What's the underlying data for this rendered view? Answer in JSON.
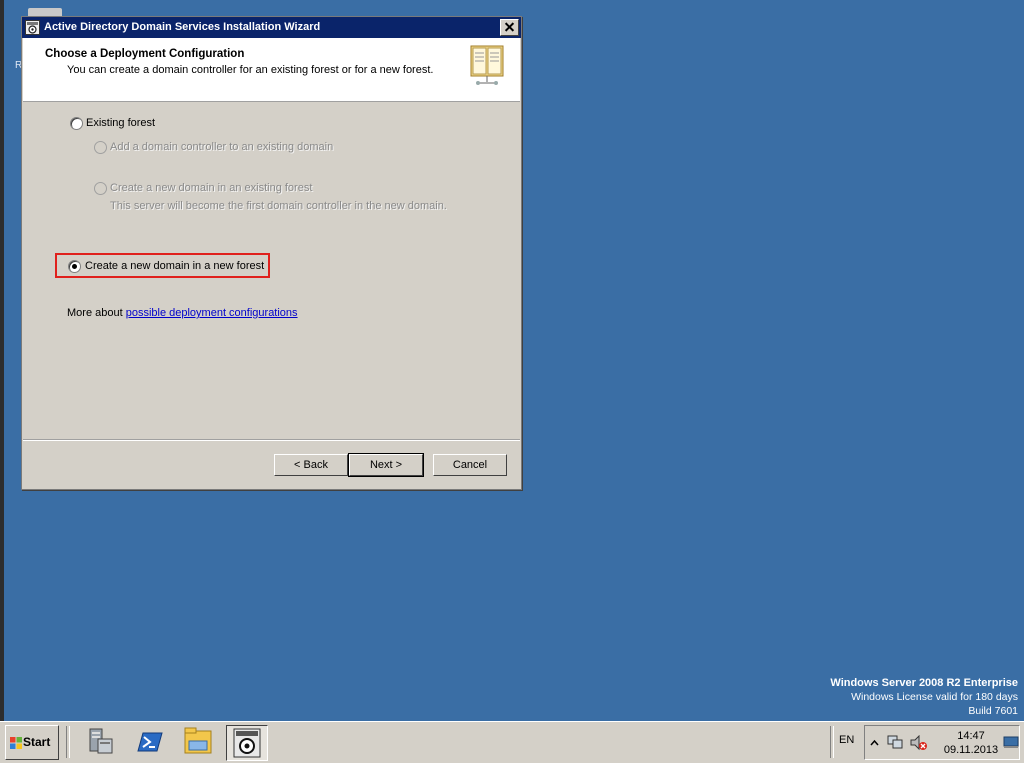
{
  "dialog": {
    "title": "Active Directory Domain Services Installation Wizard",
    "header_title": "Choose a Deployment Configuration",
    "header_subtitle": "You can create a domain controller for an existing forest or for a new forest.",
    "options": {
      "existing_forest": "Existing forest",
      "add_dc": "Add a domain controller to an existing domain",
      "new_domain_existing": "Create a new domain in an existing forest",
      "new_domain_existing_desc": "This server will become the first domain controller in the new domain.",
      "new_forest": "Create a new domain in a new forest"
    },
    "selected_option": "new_forest",
    "more_prefix": "More about",
    "more_link": "possible deployment configurations",
    "buttons": {
      "back": "< Back",
      "next": "Next >",
      "cancel": "Cancel"
    }
  },
  "desktop": {
    "edge_letter": "R",
    "watermark": {
      "title": "Windows Server 2008 R2 Enterprise",
      "license": "Windows License valid for 180 days",
      "build": "Build 7601"
    }
  },
  "taskbar": {
    "start_label": "Start",
    "pinned_icons": [
      "server-manager-icon",
      "powershell-icon",
      "explorer-folder-icon",
      "ad-wizard-icon"
    ],
    "tray": {
      "language": "EN",
      "time": "14:47",
      "date": "09.11.2013",
      "icons": [
        "show-hidden-icons-icon",
        "network-icon",
        "volume-muted-icon",
        "show-desktop-icon"
      ]
    }
  },
  "colors": {
    "desktop": "#3a6ea5",
    "titlebar": "#0a246a",
    "highlight_box": "#e0201c",
    "link": "#0000cc"
  }
}
